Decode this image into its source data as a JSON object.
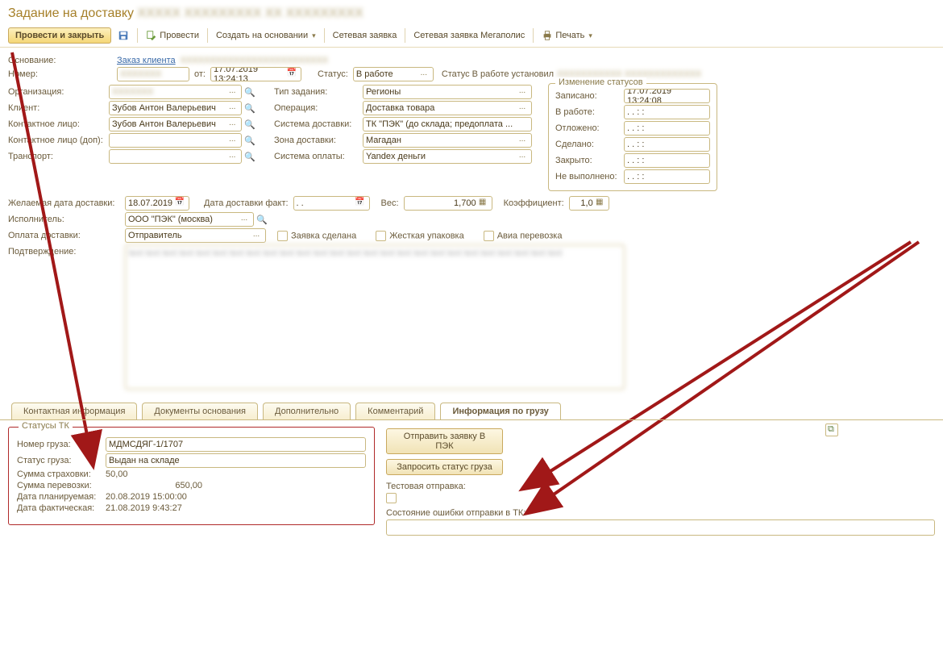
{
  "window": {
    "title": "Задание на доставку"
  },
  "toolbar": {
    "post_close": "Провести и закрыть",
    "provesti": "Провести",
    "create_based": "Создать на основании",
    "net_request": "Сетевая заявка",
    "net_request_mega": "Сетевая заявка Мегаполис",
    "print": "Печать"
  },
  "labels": {
    "osnovanie": "Основание:",
    "nomer": "Номер:",
    "ot": "от:",
    "status": "Статус:",
    "status_set_by": "Статус В работе установил",
    "organization": "Организация:",
    "client": "Клиент:",
    "contact": "Контактное лицо:",
    "contact_dop": "Контактное лицо (доп):",
    "transport": "Транспорт:",
    "type_task": "Тип задания:",
    "operation": "Операция:",
    "delivery_system": "Система доставки:",
    "delivery_zone": "Зона доставки:",
    "payment_system": "Система оплаты:",
    "status_change": "Изменение статусов",
    "recorded": "Записано:",
    "in_work": "В работе:",
    "postponed": "Отложено:",
    "done": "Сделано:",
    "closed": "Закрыто:",
    "not_done": "Не выполнено:",
    "desired_date": "Желаемая дата доставки:",
    "fact_date": "Дата доставки факт:",
    "weight": "Вес:",
    "koef": "Коэффициент:",
    "executor": "Исполнитель:",
    "delivery_payment": "Оплата доставки:",
    "request_done": "Заявка сделана",
    "hard_pack": "Жесткая упаковка",
    "avia": "Авиа перевозка",
    "confirmation": "Подтверждение:"
  },
  "values": {
    "osnovanie_link": "Заказ клиента",
    "nomer": " ",
    "date": "17.07.2019 13:24:13",
    "status": "В работе",
    "client": "Зубов Антон Валерьевич",
    "contact": "Зубов Антон Валерьевич",
    "type_task": "Регионы",
    "operation": "Доставка товара",
    "delivery_system": "ТК \"ПЭК\" (до склада; предоплата ...",
    "delivery_zone": "Магадан",
    "payment_system": "Yandex деньги",
    "recorded": "17.07.2019 13:24:08",
    "empty_date": " .  .       :  :",
    "desired_date": "18.07.2019",
    "fact_date": " .  .",
    "weight": "1,700",
    "koef": "1,0",
    "executor": "ООО \"ПЭК\" (москва)",
    "delivery_payment": "Отправитель"
  },
  "tabs": {
    "contact": "Контактная информация",
    "docs": "Документы основания",
    "dop": "Дополнительно",
    "comment": "Комментарий",
    "cargo": "Информация по грузу"
  },
  "cargo": {
    "fieldset_title": "Статусы ТК",
    "nomer_label": "Номер груза:",
    "nomer": "МДМСДЯГ-1/1707",
    "status_label": "Статус груза:",
    "status": "Выдан на складе",
    "insurance_label": "Сумма страховки:",
    "insurance": "50,00",
    "shipping_label": "Сумма перевозки:",
    "shipping": "650,00",
    "plan_date_label": "Дата планируемая:",
    "plan_date": "20.08.2019 15:00:00",
    "fact_date_label": "Дата фактическая:",
    "fact_date": "21.08.2019 9:43:27",
    "send_btn": "Отправить заявку В ПЭК",
    "request_btn": "Запросить статус груза",
    "test_send": "Тестовая отправка:",
    "error_state": "Состояние ошибки отправки в ТК:"
  }
}
